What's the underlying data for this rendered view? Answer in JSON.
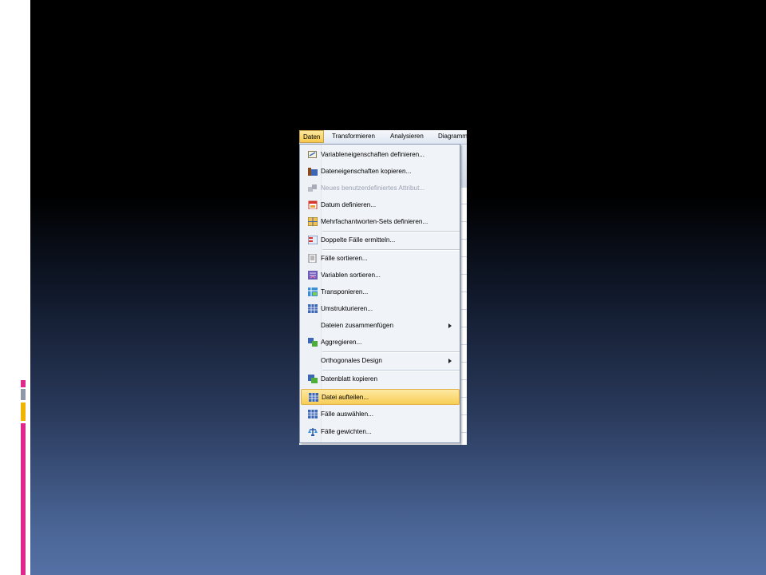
{
  "menubar": {
    "items": [
      "Daten",
      "Transformieren",
      "Analysieren",
      "Diagramm"
    ]
  },
  "menu": {
    "items": [
      {
        "label": "Variableneigenschaften definieren...",
        "icon": "variable-properties-icon"
      },
      {
        "label": "Dateneigenschaften kopieren...",
        "icon": "copy-data-properties-icon"
      },
      {
        "label": "Neues benutzerdefiniertes Attribut...",
        "icon": "custom-attribute-icon",
        "disabled": true
      },
      {
        "label": "Datum definieren...",
        "icon": "calendar-icon"
      },
      {
        "label": "Mehrfachantworten-Sets definieren...",
        "icon": "multiple-response-icon"
      },
      {
        "label": "Doppelte Fälle ermitteln...",
        "icon": "duplicate-cases-icon"
      },
      {
        "label": "Fälle sortieren...",
        "icon": "sort-cases-icon"
      },
      {
        "label": "Variablen sortieren...",
        "icon": "sort-variables-icon"
      },
      {
        "label": "Transponieren...",
        "icon": "transpose-icon"
      },
      {
        "label": "Umstrukturieren...",
        "icon": "restructure-icon"
      },
      {
        "label": "Dateien zusammenfügen",
        "icon": "",
        "submenu": true
      },
      {
        "label": "Aggregieren...",
        "icon": "aggregate-icon"
      },
      {
        "label": "Orthogonales Design",
        "icon": "",
        "submenu": true
      },
      {
        "label": "Datenblatt kopieren",
        "icon": "copy-dataset-icon"
      },
      {
        "label": "Datei aufteilen...",
        "icon": "split-file-icon",
        "highlighted": true
      },
      {
        "label": "Fälle auswählen...",
        "icon": "select-cases-icon"
      },
      {
        "label": "Fälle gewichten...",
        "icon": "weight-cases-icon"
      }
    ]
  },
  "colors": {
    "highlight": "#f8cd55",
    "bar_pink": "#e0288c",
    "bar_gray": "#8d99a8",
    "bar_yellow": "#f0b400"
  }
}
